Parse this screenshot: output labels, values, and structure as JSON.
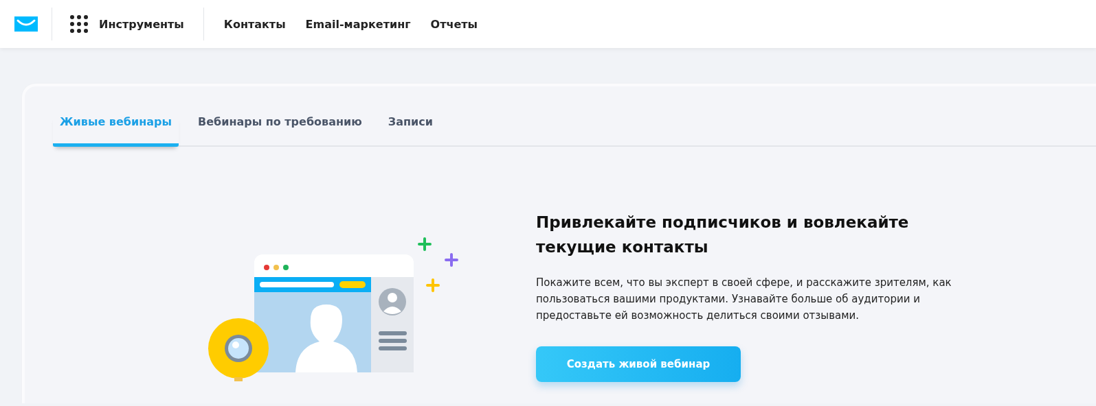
{
  "top_nav": {
    "tools_label": "Инструменты",
    "links": [
      "Контакты",
      "Email-маркетинг",
      "Отчеты"
    ]
  },
  "tabs": [
    {
      "label": "Живые вебинары",
      "selected": true
    },
    {
      "label": "Вебинары по требованию",
      "selected": false
    },
    {
      "label": "Записи",
      "selected": false
    }
  ],
  "promo": {
    "heading": "Привлекайте подписчиков и вовлекайте текущие контакты",
    "text": "Покажите всем, что вы эксперт в своей сфере, и расскажите зрителям, как пользоваться вашими продуктами. Узнавайте больше об аудитории и предоставьте ей возможность делиться своими отзывами.",
    "button": "Создать живой вебинар"
  }
}
